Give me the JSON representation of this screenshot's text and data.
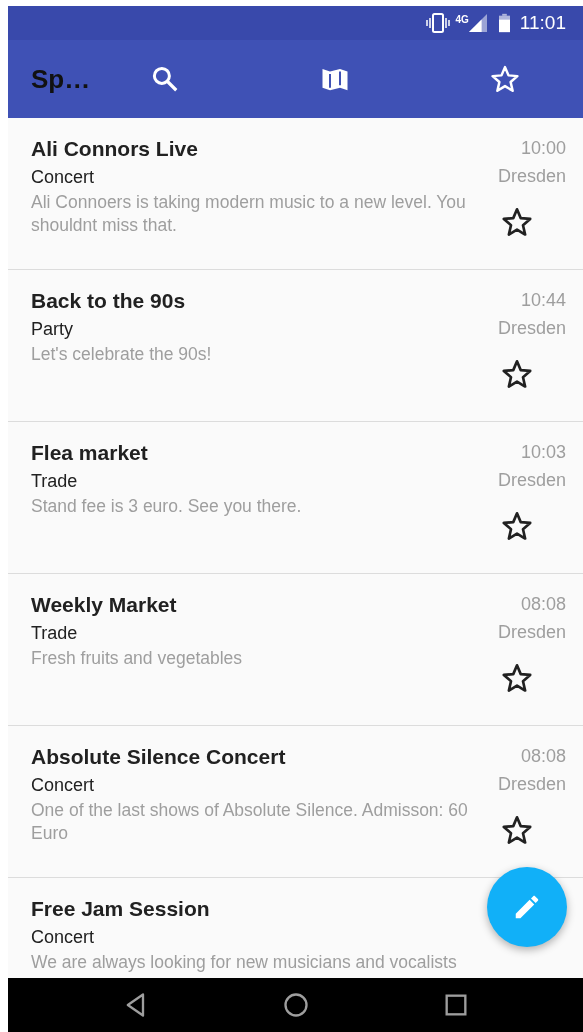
{
  "status_bar": {
    "network": "4G",
    "time": "11:01"
  },
  "app_bar": {
    "title": "Sp…"
  },
  "events": [
    {
      "title": "Ali Connors Live",
      "category": "Concert",
      "description": "Ali Connoers is taking modern music to a new level. You shouldnt miss that.",
      "time": "10:00",
      "location": "Dresden",
      "starred": false
    },
    {
      "title": "Back to the 90s",
      "category": "Party",
      "description": "Let's celebrate the 90s!",
      "time": "10:44",
      "location": "Dresden",
      "starred": false
    },
    {
      "title": "Flea market",
      "category": "Trade",
      "description": "Stand fee is 3 euro. See you there.",
      "time": "10:03",
      "location": "Dresden",
      "starred": false
    },
    {
      "title": "Weekly Market",
      "category": "Trade",
      "description": "Fresh fruits and vegetables",
      "time": "08:08",
      "location": "Dresden",
      "starred": false
    },
    {
      "title": "Absolute Silence Concert",
      "category": "Concert",
      "description": "One of the last shows of Absolute Silence. Admisson: 60 Euro",
      "time": "08:08",
      "location": "Dresden",
      "starred": false
    },
    {
      "title": "Free Jam Session",
      "category": "Concert",
      "description": "We are always looking for new musicians and vocalists"
    }
  ]
}
